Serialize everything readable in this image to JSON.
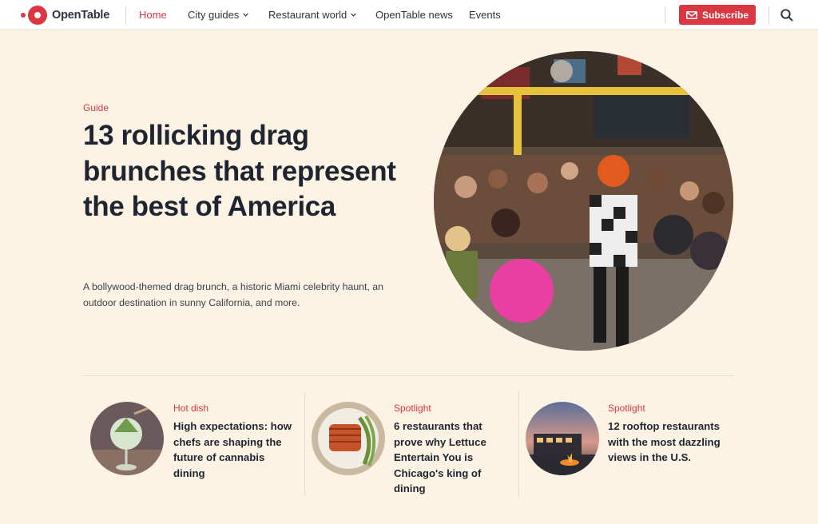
{
  "nav": {
    "brand": "OpenTable",
    "links": [
      {
        "label": "Home",
        "active": true
      },
      {
        "label": "City guides",
        "dropdown": true
      },
      {
        "label": "Restaurant world",
        "dropdown": true
      },
      {
        "label": "OpenTable news"
      },
      {
        "label": "Events"
      }
    ],
    "subscribe_label": "Subscribe",
    "search_icon": "search-icon"
  },
  "hero": {
    "eyebrow": "Guide",
    "title": "13 rollicking drag brunches that represent the best of America",
    "description": "A bollywood-themed drag brunch, a historic Miami celebrity haunt, an outdoor destination in sunny California, and more."
  },
  "cards": [
    {
      "eyebrow": "Hot dish",
      "title": "High expectations: how chefs are shaping the future of cannabis dining"
    },
    {
      "eyebrow": "Spotlight",
      "title": "6 restaurants that prove why Lettuce Entertain You is Chicago's king of dining"
    },
    {
      "eyebrow": "Spotlight",
      "title": "12 rooftop restaurants with the most dazzling views in the U.S."
    }
  ],
  "colors": {
    "brand": "#da3743",
    "background": "#fdf3e5",
    "text": "#2d333f"
  }
}
